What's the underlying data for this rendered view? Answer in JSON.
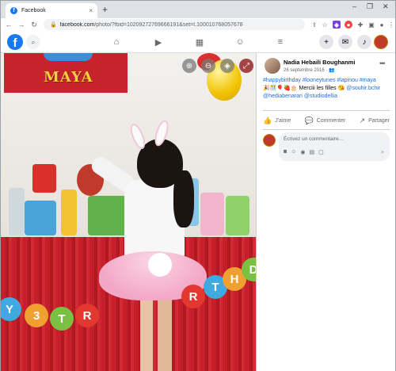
{
  "browser": {
    "tab_title": "Facebook",
    "tab_close": "×",
    "new_tab": "+",
    "url_host": "facebook.com",
    "url_path": "/photo/?fbid=10209272769666191&set=t.100010768057678",
    "controls": {
      "minimize": "–",
      "maximize": "❐",
      "close": "✕"
    },
    "nav": {
      "back": "←",
      "forward": "→",
      "reload": "↻"
    }
  },
  "fb_header": {
    "logo": "f",
    "nav_icons": [
      "home-icon",
      "video-icon",
      "marketplace-icon",
      "groups-icon",
      "menu-icon"
    ],
    "right_icons": [
      "create-icon",
      "messenger-icon",
      "notifications-icon"
    ]
  },
  "photo": {
    "banner_text": "MAYA",
    "garland_letters": [
      "Y",
      "3",
      "T",
      "R",
      "T",
      "H",
      "D"
    ]
  },
  "post": {
    "author": "Nadia Hebaili Boughanmi",
    "date": "26 septembre 2016 · ",
    "text_tags": "#happybirthday #looneytunes #lapinou #maya",
    "text_body": " Merciii les filles ",
    "mentions": "@souhir.bchir @hediabenarari @studiodellia",
    "actions": {
      "like": "J'aime",
      "comment": "Commenter",
      "share": "Partager"
    },
    "comment_placeholder": "Écrivez un commentaire…"
  }
}
